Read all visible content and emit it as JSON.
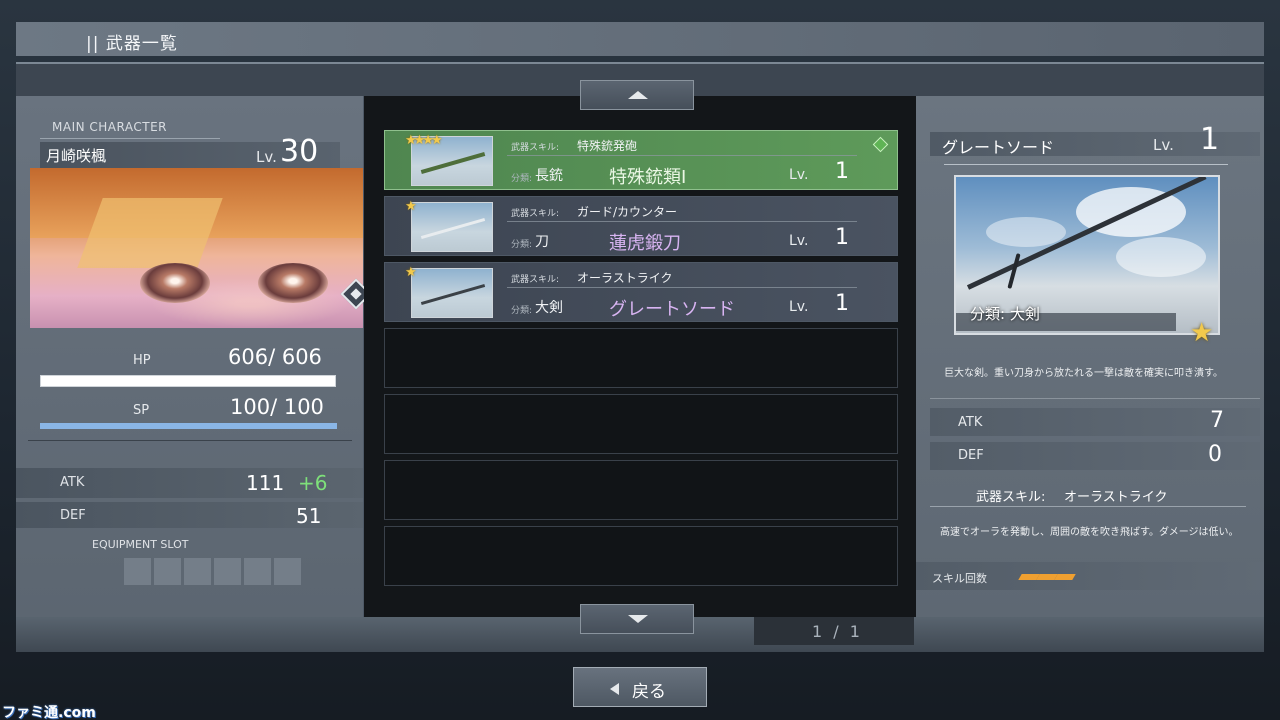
{
  "header": {
    "title": "|| 武器一覧"
  },
  "character": {
    "section_label": "MAIN CHARACTER",
    "name": "月崎咲楓",
    "lv_label": "Lv.",
    "lv": "30",
    "hp_label": "HP",
    "hp_text": "606/ 606",
    "sp_label": "SP",
    "sp_text": "100/ 100",
    "hp_fraction": 1.0,
    "sp_fraction": 1.0,
    "atk_label": "ATK",
    "atk": "111",
    "atk_bonus": "+6",
    "def_label": "DEF",
    "def": "51",
    "equipment_slot_label": "EQUIPMENT SLOT",
    "equipment_slots": 6
  },
  "weapons": [
    {
      "stars": "★★★★",
      "skill_label": "武器スキル:",
      "skill": "特殊銃発砲",
      "class_label": "分類:",
      "class": "長銃",
      "name": "特殊銃類I",
      "lv_label": "Lv.",
      "lv": "1",
      "selected": true
    },
    {
      "stars": "★",
      "skill_label": "武器スキル:",
      "skill": "ガード/カウンター",
      "class_label": "分類:",
      "class": "刀",
      "name": "蓮虎鍛刀",
      "lv_label": "Lv.",
      "lv": "1",
      "selected": false
    },
    {
      "stars": "★",
      "skill_label": "武器スキル:",
      "skill": "オーラストライク",
      "class_label": "分類:",
      "class": "大剣",
      "name": "グレートソード",
      "lv_label": "Lv.",
      "lv": "1",
      "selected": false
    }
  ],
  "empty_rows": 4,
  "pagination": {
    "text": "1 / 1"
  },
  "detail": {
    "name": "グレートソード",
    "lv_label": "Lv.",
    "lv": "1",
    "class_text": "分類: 大剣",
    "star": "★",
    "description": "巨大な剣。重い刀身から放たれる一撃は敵を確実に叩き潰す。",
    "atk_label": "ATK",
    "atk": "7",
    "def_label": "DEF",
    "def": "0",
    "skill_label": "武器スキル:",
    "skill": "オーラストライク",
    "skill_description": "高速でオーラを発動し、周囲の敵を吹き飛ばす。ダメージは低い。",
    "skill_count_label": "スキル回数",
    "skill_count": 3
  },
  "back_button": {
    "label": "戻る"
  },
  "watermark": "ファミ通.com",
  "colors": {
    "selected_row": "#5e9a5a",
    "weapon_name": "#d8b4f2",
    "atk_bonus": "#7ee07a",
    "star": "#f2c94c",
    "skill_pip": "#f0a030"
  }
}
